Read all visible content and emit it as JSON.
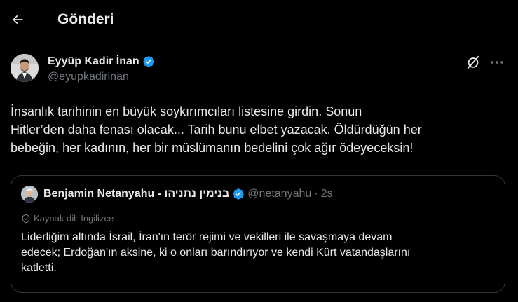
{
  "header": {
    "title": "Gönderi",
    "back_icon": "arrow-left-icon"
  },
  "tweet": {
    "author_name": "Eyyüp Kadir İnan",
    "handle": "@eyupkadirinan",
    "verified": true,
    "text": "İnsanlık tarihinin en büyük soykırımcıları listesine girdin. Sonun\nHitler’den daha fenası olacak... Tarih bunu elbet yazacak. Öldürdüğün her\nbebeğin, her kadının, her bir müslümanın bedelini çok ağır ödeyeceksin!",
    "actions": [
      "grok-icon",
      "more-icon"
    ]
  },
  "quote": {
    "author_name": "Benjamin Netanyahu - בנימין נתניהו",
    "handle": "@netanyahu",
    "separator": "·",
    "time": "2s",
    "verified": true,
    "translation_label": "Kaynak dil: İngilizce",
    "text": "Liderliğim altında İsrail, İran'ın terör rejimi ve vekilleri ile savaşmaya devam\nedecek; Erdoğan'ın aksine, ki o onları barındırıyor ve kendi Kürt vatandaşlarını\nkatletti."
  },
  "colors": {
    "background": "#000000",
    "text": "#e7e9ea",
    "secondary": "#71767b",
    "verified": "#1d9bf0",
    "border": "#333639"
  }
}
